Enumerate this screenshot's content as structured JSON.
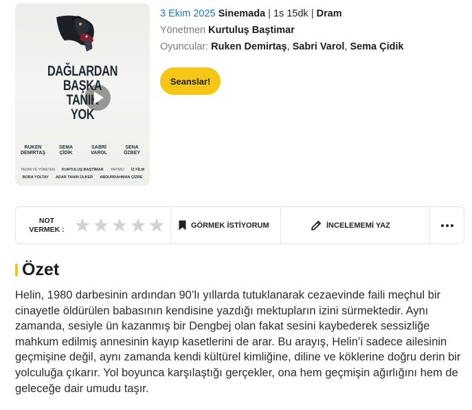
{
  "poster": {
    "title_lines": [
      "DAĞLARDAN",
      "BAŞKA",
      "TANIK",
      "YOK"
    ],
    "cast": [
      "RUKEN\nDEMİRTAŞ",
      "SEMA\nÇİDİK",
      "SABRİ\nVAROL",
      "SENA\nÖZBEY"
    ],
    "credits_row1": {
      "left_label": "YAZAN VE YÖNETEN",
      "left_name": "KURTULUŞ BAŞTİMAR",
      "right_label": "YAPIMCI",
      "right_name": "İZ FİLM"
    },
    "credits_row2": {
      "a": "BORA YOLTAY",
      "b": "ADAR TANIN ÜLKER",
      "c": "ABDURRAHMAN ÇİZRE"
    }
  },
  "meta": {
    "date": "3 Ekim 2025",
    "status": "Sinemada",
    "separator": "|",
    "duration": "1s 15dk",
    "genre": "Dram",
    "director_label": "Yönetmen",
    "director": "Kurtuluş Baştimar",
    "cast_label": "Oyuncular:",
    "cast": [
      "Ruken Demirtaş",
      "Sabri Varol",
      "Sema Çidik"
    ],
    "cast_sep": ", "
  },
  "buttons": {
    "sessions": "Seanslar!"
  },
  "actions": {
    "rate_label_1": "NOT",
    "rate_label_2": "VERMEK :",
    "stars_count": 5,
    "watch_label": "GÖRMEK İSTİYORUM",
    "review_label": "İNCELEMEMİ YAZ",
    "icons": {
      "watch": "bookmark-icon",
      "review": "pencil-icon",
      "more": "more-dots-icon",
      "star": "star-icon"
    }
  },
  "summary": {
    "title": "Özet",
    "text": "Helin, 1980 darbesinin ardından 90’lı yıllarda tutuklanarak cezaevinde faili meçhul bir cinayetle öldürülen babasının kendisine yazdığı mektupların izini sürmektedir. Aynı zamanda, sesiyle ün kazanmış bir Dengbej olan fakat sesini kaybederek sessizliğe mahkum edilmiş annesinin kayıp kasetlerini de arar. Bu arayış, Helin’i sadece ailesinin geçmişine değil, aynı zamanda kendi kültürel kimliğine, diline ve köklerine doğru derin bir yolculuğa çıkarır. Yol boyunca karşılaştığı gerçekler, ona hem geçmişin ağırlığını hem de geleceğe dair umudu taşır."
  },
  "colors": {
    "accent": "#f5c615",
    "link_blue": "#1f74b5",
    "border": "#e3e3e3",
    "star_empty": "#d2d2d2"
  }
}
